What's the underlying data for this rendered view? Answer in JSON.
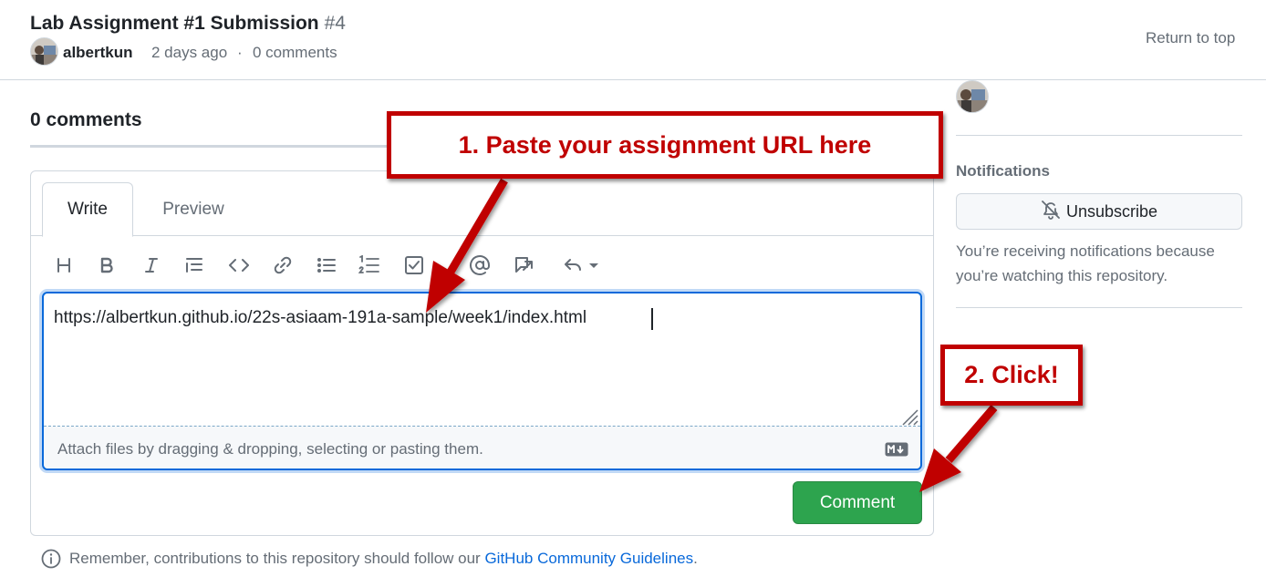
{
  "colors": {
    "accent": "#0969da",
    "success": "#2da44e",
    "annotation": "#c00000",
    "muted": "#656d76",
    "border": "#d0d7de"
  },
  "issue": {
    "title": "Lab Assignment #1 Submission",
    "number": "#4",
    "author": "albertkun",
    "time": "2 days ago",
    "separator": "·",
    "comments_count": "0 comments",
    "return_to_top": "Return to top"
  },
  "timeline": {
    "heading": "0 comments"
  },
  "editor": {
    "tabs": [
      {
        "label": "Write",
        "selected": true
      },
      {
        "label": "Preview",
        "selected": false
      }
    ],
    "toolbar_icons": [
      "heading-icon",
      "bold-icon",
      "italic-icon",
      "quote-icon",
      "code-icon",
      "link-icon",
      "bulleted-list-icon",
      "numbered-list-icon",
      "task-list-icon",
      "mention-icon",
      "reference-icon",
      "saved-replies-icon"
    ],
    "value": "https://albertkun.github.io/22s-asiaam-191a-sample/week1/index.html",
    "attach_hint": "Attach files by dragging & dropping, selecting or pasting them.",
    "markdown_icon": "markdown-icon",
    "submit_label": "Comment"
  },
  "footer": {
    "notice_prefix": "Remember, contributions to this repository should follow our ",
    "notice_link": "GitHub Community Guidelines",
    "notice_suffix": "."
  },
  "sidebar": {
    "notifications_heading": "Notifications",
    "unsubscribe_label": "Unsubscribe",
    "reason": "You’re receiving notifications because you’re watching this repository."
  },
  "annotations": {
    "step1": "1. Paste your assignment URL here",
    "step2": "2. Click!"
  }
}
